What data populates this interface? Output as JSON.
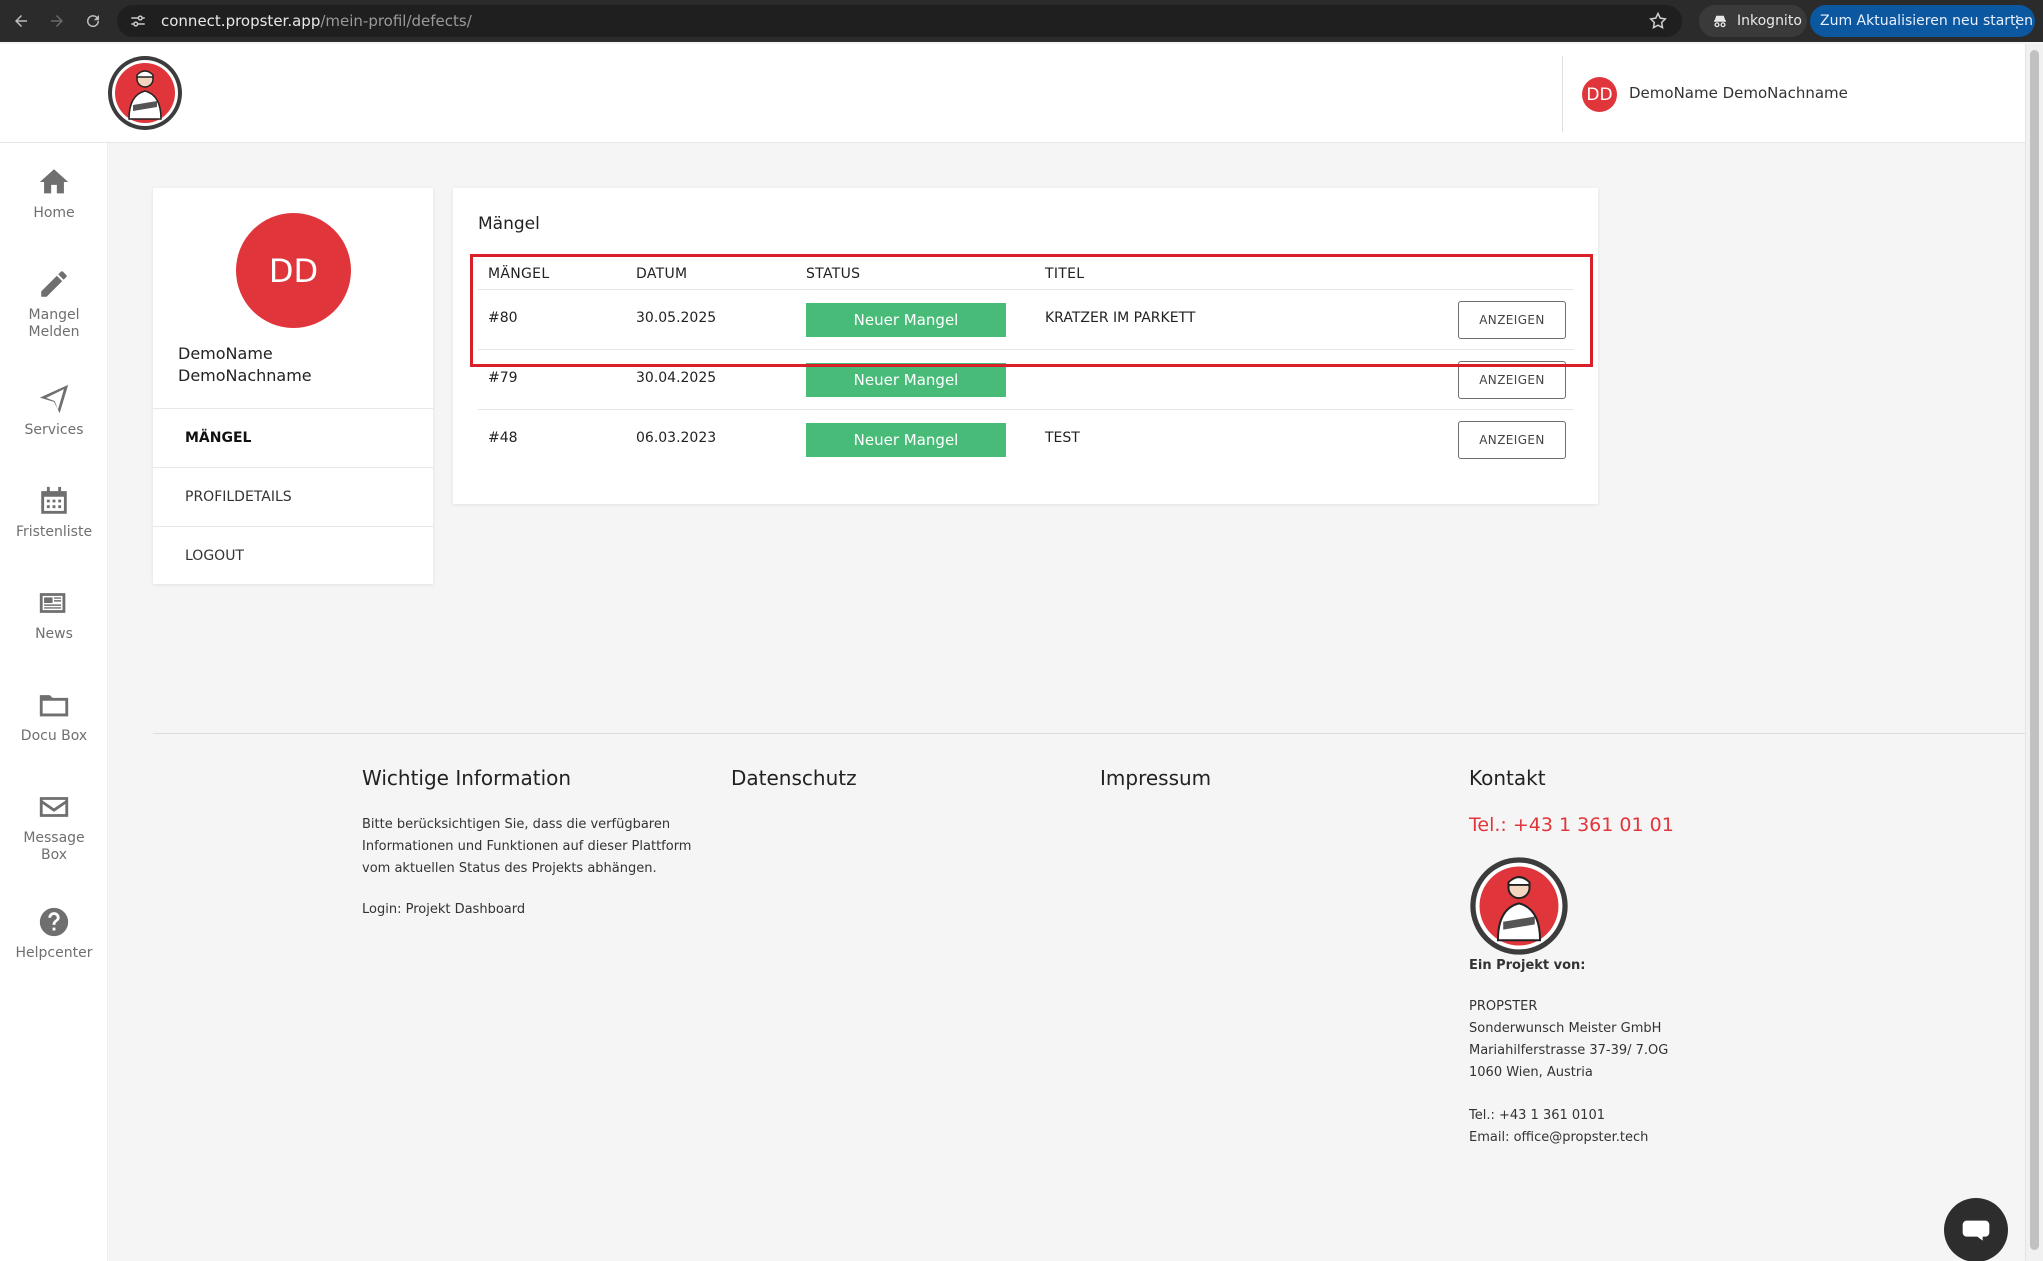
{
  "browser": {
    "url_host": "connect.propster.app",
    "url_path": "/mein-profil/defects/",
    "incognito_label": "Inkognito",
    "update_label": "Zum Aktualisieren neu starten"
  },
  "header": {
    "avatar_initials": "DD",
    "user_name": "DemoName DemoNachname"
  },
  "sidebar": {
    "items": [
      {
        "label": "Home",
        "icon": "home-icon"
      },
      {
        "label": "Mangel\nMelden",
        "icon": "pencil-icon"
      },
      {
        "label": "Services",
        "icon": "paper-plane-icon"
      },
      {
        "label": "Fristenliste",
        "icon": "calendar-icon"
      },
      {
        "label": "News",
        "icon": "newspaper-icon"
      },
      {
        "label": "Docu Box",
        "icon": "folder-icon"
      },
      {
        "label": "Message\nBox",
        "icon": "envelope-icon"
      },
      {
        "label": "Helpcenter",
        "icon": "question-icon"
      }
    ]
  },
  "profile": {
    "initials": "DD",
    "first_name": "DemoName",
    "last_name": "DemoNachname",
    "menu": [
      "MÄNGEL",
      "PROFILDETAILS",
      "LOGOUT"
    ]
  },
  "defects": {
    "title": "Mängel",
    "columns": [
      "MÄNGEL",
      "DATUM",
      "STATUS",
      "TITEL"
    ],
    "rows": [
      {
        "id": "#80",
        "date": "30.05.2025",
        "status": "Neuer Mangel",
        "title": "KRATZER IM PARKETT",
        "action": "ANZEIGEN"
      },
      {
        "id": "#79",
        "date": "30.04.2025",
        "status": "Neuer Mangel",
        "title": "",
        "action": "ANZEIGEN"
      },
      {
        "id": "#48",
        "date": "06.03.2023",
        "status": "Neuer Mangel",
        "title": "TEST",
        "action": "ANZEIGEN"
      }
    ],
    "status_color": "#48bb78",
    "highlight_color": "#d9202a"
  },
  "footer": {
    "info_title": "Wichtige Information",
    "info_text_1": "Bitte berücksichtigen Sie, dass die verfügbaren",
    "info_text_2": "Informationen und Funktionen auf dieser Plattform",
    "info_text_3": "vom aktuellen Status des Projekts abhängen.",
    "login_text": "Login: Projekt Dashboard",
    "privacy_title": "Datenschutz",
    "imprint_title": "Impressum",
    "contact_title": "Kontakt",
    "phone_display": "Tel.: +43 1 361 01 01",
    "project_by": "Ein Projekt von:",
    "company": "PROPSTER",
    "company_2": "Sonderwunsch Meister GmbH",
    "street": "Mariahilferstrasse 37-39/ 7.OG",
    "city": "1060 Wien, Austria",
    "tel": "Tel.: +43 1 361 0101",
    "email": "Email: office@propster.tech"
  },
  "colors": {
    "accent": "#e0353b",
    "chrome": "#2b2b2b"
  }
}
